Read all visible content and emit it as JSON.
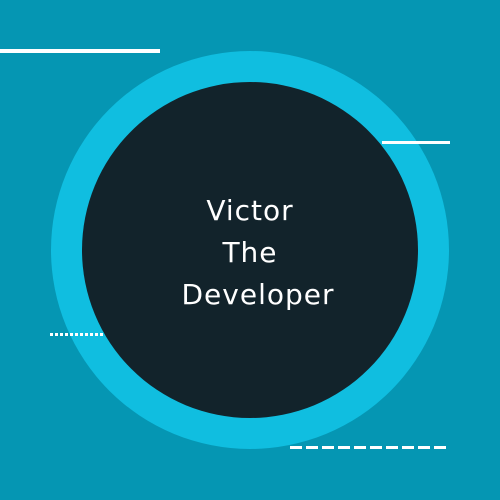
{
  "logo": {
    "lines": [
      "Victor",
      "The",
      "Developer"
    ]
  },
  "colors": {
    "background": "#0596b3",
    "ring": "#10bee0",
    "disc": "#12232b",
    "text": "#ffffff",
    "decorative_lines": "#ffffff"
  }
}
